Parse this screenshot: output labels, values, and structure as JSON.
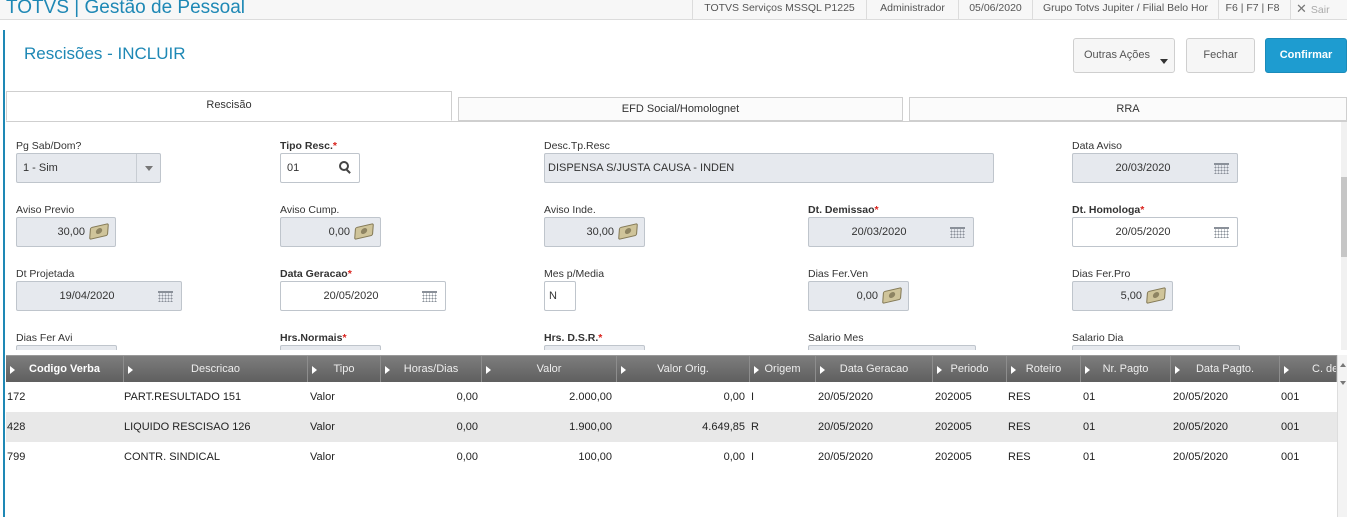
{
  "topbar": {
    "app_title": "TOTVS | Gestão de Pessoal",
    "environment": "TOTVS Serviços MSSQL P1225",
    "user": "Administrador",
    "date": "05/06/2020",
    "company": "Grupo Totvs Jupiter / Filial Belo Hor",
    "shortcuts": "F6 | F7 | F8",
    "exit_label": "Sair"
  },
  "header": {
    "title": "Rescisões - INCLUIR",
    "more_actions": "Outras Ações",
    "close": "Fechar",
    "confirm": "Confirmar"
  },
  "tabs": {
    "rescisao": "Rescisão",
    "efd": "EFD Social/Homolognet",
    "rra": "RRA"
  },
  "form": {
    "pg_sab_dom": {
      "label": "Pg Sab/Dom?",
      "value": "1 - Sim"
    },
    "tipo_resc": {
      "label": "Tipo Resc.",
      "value": "01"
    },
    "desc_tp_resc": {
      "label": "Desc.Tp.Resc",
      "value": "DISPENSA S/JUSTA CAUSA - INDEN"
    },
    "data_aviso": {
      "label": "Data Aviso",
      "value": "20/03/2020"
    },
    "aviso_previo": {
      "label": "Aviso Previo",
      "value": "30,00"
    },
    "aviso_cump": {
      "label": "Aviso Cump.",
      "value": "0,00"
    },
    "aviso_inde": {
      "label": "Aviso Inde.",
      "value": "30,00"
    },
    "dt_demissao": {
      "label": "Dt. Demissao",
      "value": "20/03/2020"
    },
    "dt_homologa": {
      "label": "Dt. Homologa",
      "value": "20/05/2020"
    },
    "dt_projetada": {
      "label": "Dt Projetada",
      "value": "19/04/2020"
    },
    "data_geracao": {
      "label": "Data Geracao",
      "value": "20/05/2020"
    },
    "mes_p_media": {
      "label": "Mes p/Media",
      "value": "N"
    },
    "dias_fer_ven": {
      "label": "Dias Fer.Ven",
      "value": "0,00"
    },
    "dias_fer_pro": {
      "label": "Dias Fer.Pro",
      "value": "5,00"
    },
    "dias_fer_avi": {
      "label": "Dias Fer Avi"
    },
    "hrs_normais": {
      "label": "Hrs.Normais"
    },
    "hrs_dsr": {
      "label": "Hrs. D.S.R."
    },
    "salario_mes": {
      "label": "Salario Mes"
    },
    "salario_dia": {
      "label": "Salario Dia"
    },
    "required_mark": "*"
  },
  "grid": {
    "columns": [
      "Codigo Verba",
      "Descricao",
      "Tipo",
      "Horas/Dias",
      "Valor",
      "Valor Orig.",
      "Origem",
      "Data Geracao",
      "Periodo",
      "Roteiro",
      "Nr. Pagto",
      "Data Pagto.",
      "C. de"
    ],
    "rows": [
      [
        "172",
        "PART.RESULTADO  151",
        "Valor",
        "0,00",
        "2.000,00",
        "0,00",
        "I",
        "20/05/2020",
        "202005",
        "RES",
        "01",
        "20/05/2020",
        "001"
      ],
      [
        "428",
        "LIQUIDO RESCISAO 126",
        "Valor",
        "0,00",
        "1.900,00",
        "4.649,85",
        "R",
        "20/05/2020",
        "202005",
        "RES",
        "01",
        "20/05/2020",
        "001"
      ],
      [
        "799",
        "CONTR. SINDICAL",
        "Valor",
        "0,00",
        "100,00",
        "0,00",
        "I",
        "20/05/2020",
        "202005",
        "RES",
        "01",
        "20/05/2020",
        "001"
      ]
    ]
  },
  "colors": {
    "accent": "#1e88b5",
    "confirm": "#1e9cd0",
    "required": "#d9221c",
    "grid_header": "#6b6b6b"
  }
}
